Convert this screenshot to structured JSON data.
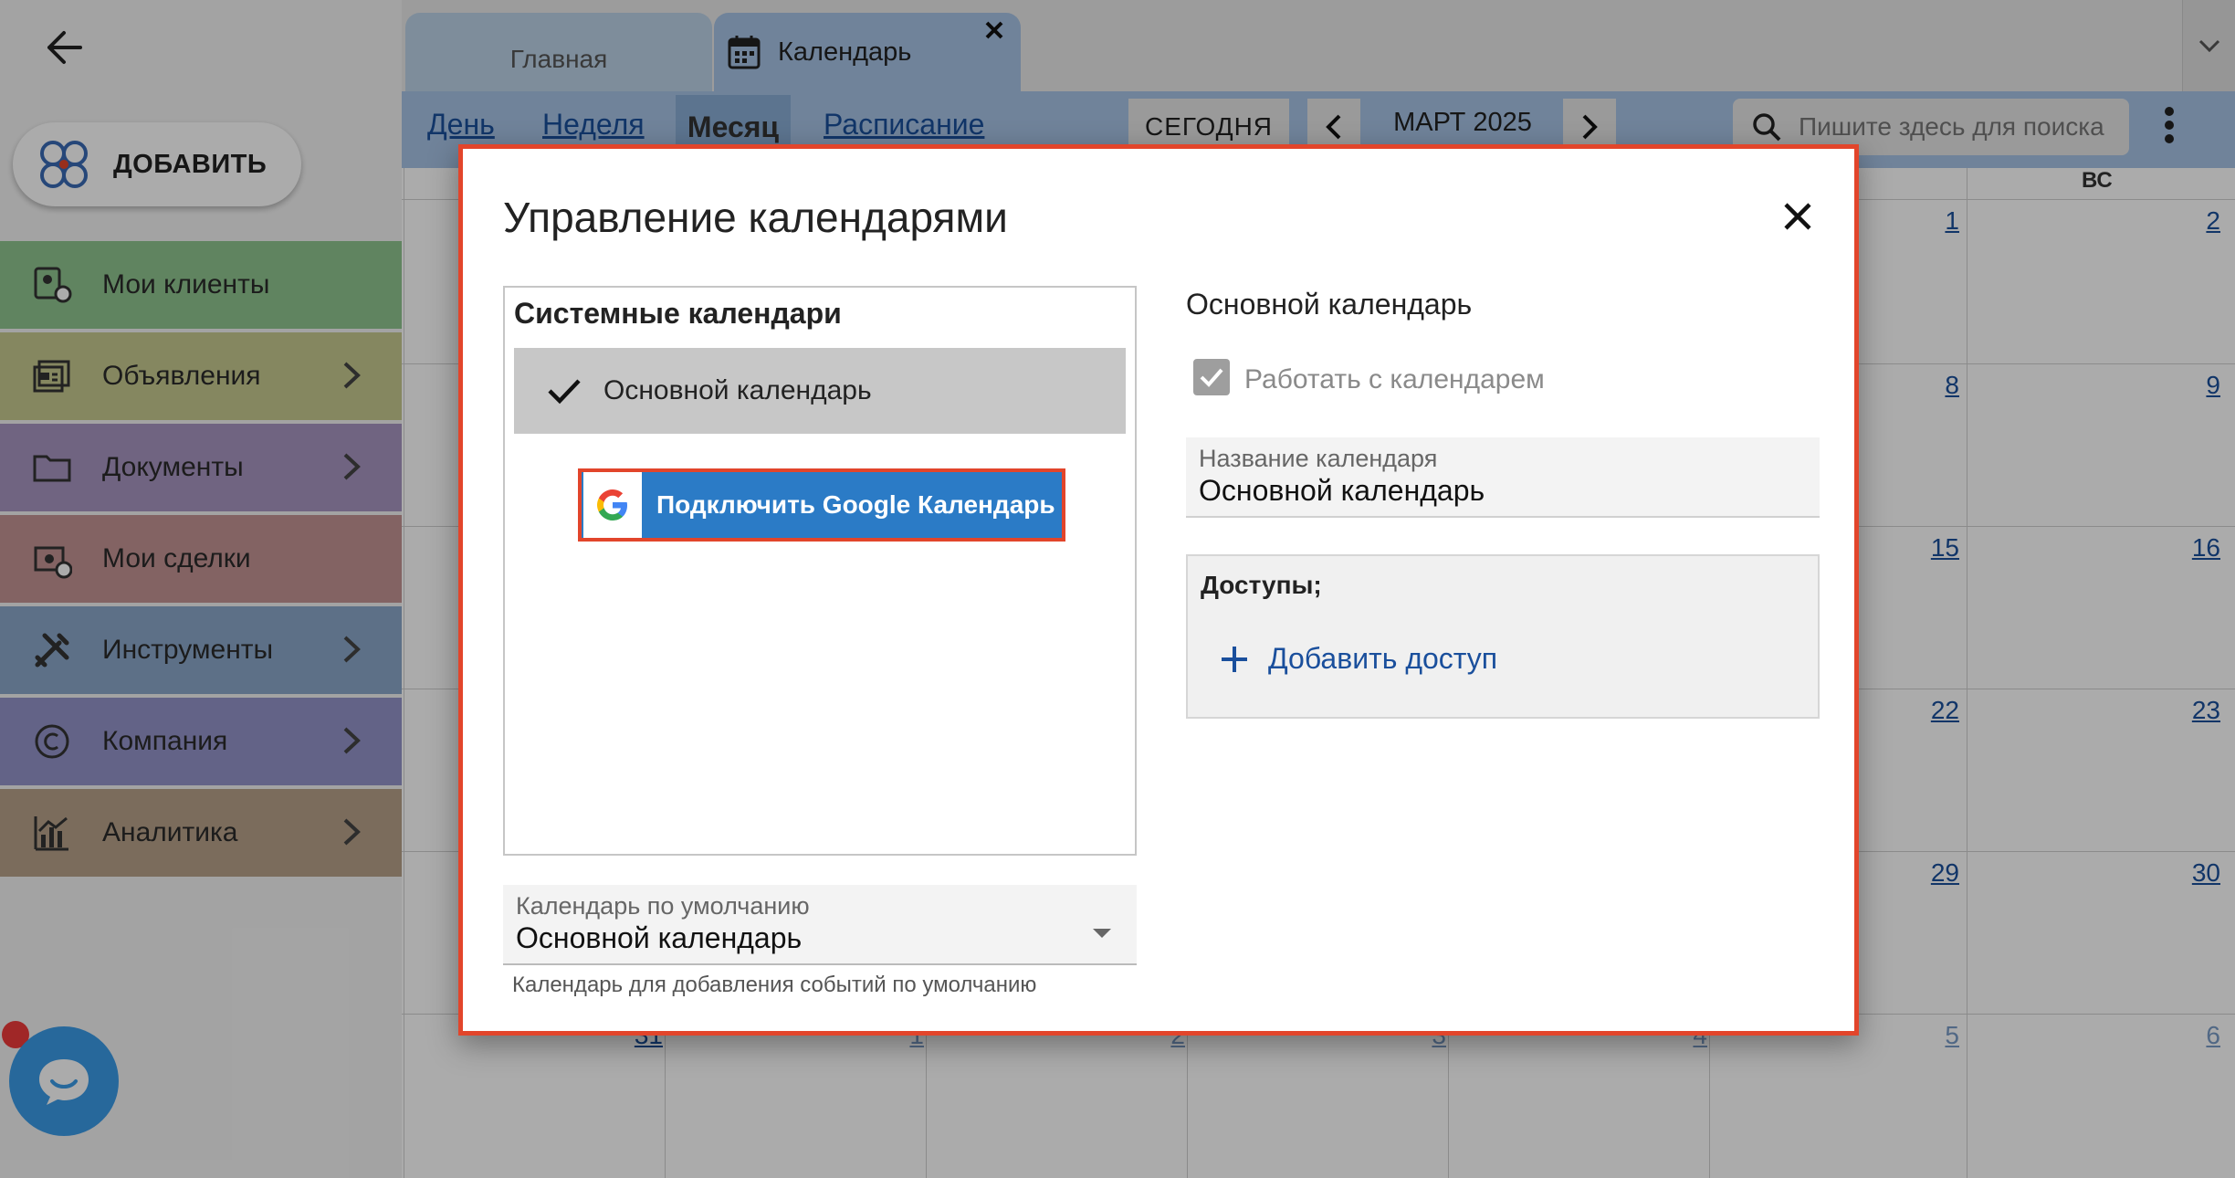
{
  "sidebar": {
    "add_label": "ДОБАВИТЬ",
    "items": [
      {
        "label": "Мои клиенты",
        "color": "#8fc58f",
        "icon": "clients-icon",
        "chevron": false
      },
      {
        "label": "Объявления",
        "color": "#c7c98f",
        "icon": "listings-icon",
        "chevron": true
      },
      {
        "label": "Документы",
        "color": "#a895c0",
        "icon": "folder-icon",
        "chevron": true
      },
      {
        "label": "Мои сделки",
        "color": "#c49494",
        "icon": "deals-icon",
        "chevron": false
      },
      {
        "label": "Инструменты",
        "color": "#8ba8c9",
        "icon": "tools-icon",
        "chevron": true
      },
      {
        "label": "Компания",
        "color": "#9494c9",
        "icon": "copyright-icon",
        "chevron": true
      },
      {
        "label": "Аналитика",
        "color": "#b8a28a",
        "icon": "analytics-icon",
        "chevron": true
      }
    ]
  },
  "tabs": {
    "home": "Главная",
    "calendar": "Календарь"
  },
  "toolbar": {
    "day": "День",
    "week": "Неделя",
    "month": "Месяц",
    "schedule": "Расписание",
    "today": "СЕГОДНЯ",
    "month_label": "МАРТ 2025",
    "search_placeholder": "Пишите здесь для поиска"
  },
  "calendar": {
    "sunday_header": "ВС",
    "day_numbers_col6": [
      "1",
      "8",
      "15",
      "22",
      "29",
      "5"
    ],
    "day_numbers_col7": [
      "2",
      "9",
      "16",
      "23",
      "30",
      "6"
    ],
    "partial_row": [
      "31",
      "1",
      "2",
      "3",
      "4"
    ]
  },
  "modal": {
    "title": "Управление календарями",
    "system_calendars_title": "Системные календари",
    "system_calendar_item": "Основной календарь",
    "google_button": "Подключить Google Календарь",
    "default_calendar_label": "Календарь по умолчанию",
    "default_calendar_value": "Основной календарь",
    "default_calendar_help": "Календарь для добавления событий по умолчанию",
    "right_title": "Основной календарь",
    "work_with_calendar": "Работать с календарем",
    "calendar_name_label": "Название календаря",
    "calendar_name_value": "Основной календарь",
    "access_label": "Доступы;",
    "add_access": "Добавить доступ"
  },
  "colors": {
    "accent_blue": "#1a4f9c",
    "toolbar_blue": "#a7c4e6",
    "highlight_red": "#e2452b",
    "google_blue": "#2b7bc6"
  }
}
